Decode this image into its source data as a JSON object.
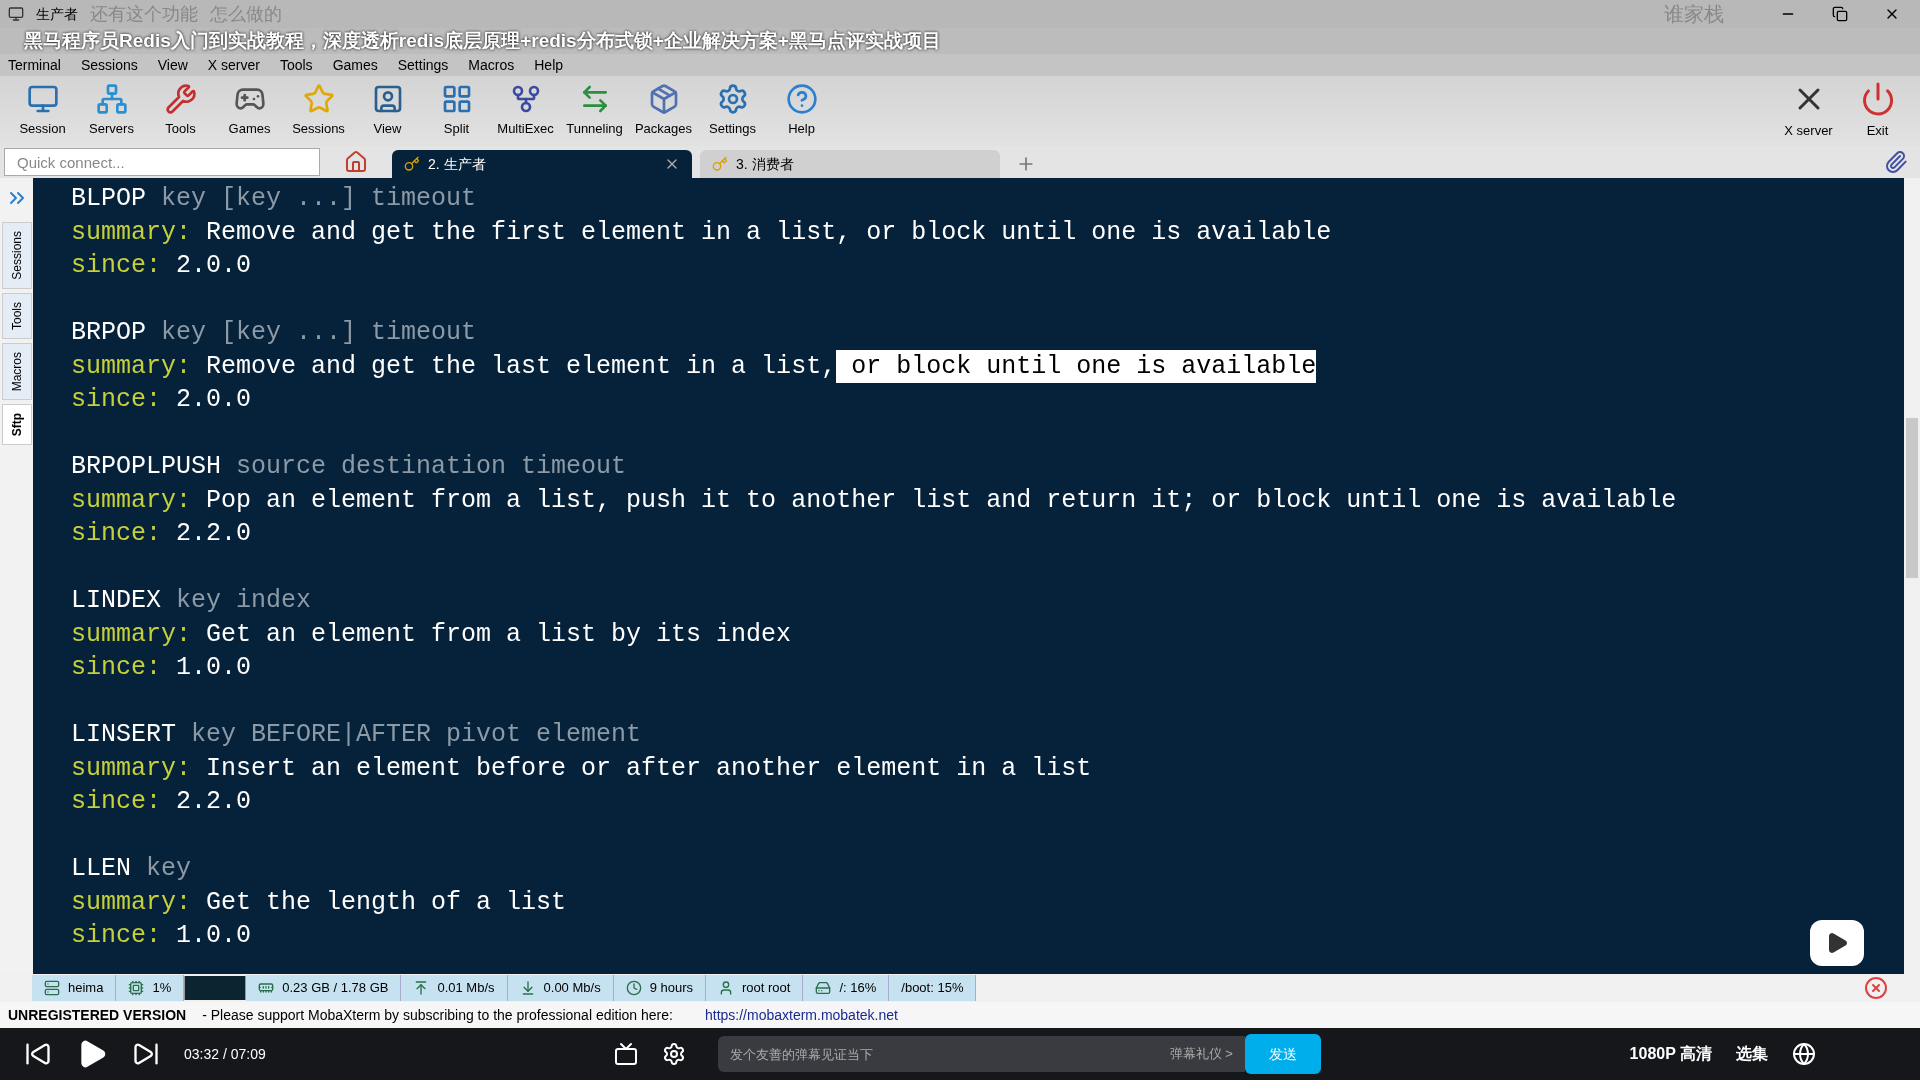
{
  "window": {
    "title": "生产者"
  },
  "danmaku": [
    "还有这个功能",
    "怎么做的",
    "谁家栈"
  ],
  "video_title": "黑马程序员Redis入门到实战教程，深度透析redis底层原理+redis分布式锁+企业解决方案+黑马点评实战项目",
  "menu": [
    "Terminal",
    "Sessions",
    "View",
    "X server",
    "Tools",
    "Games",
    "Settings",
    "Macros",
    "Help"
  ],
  "toolbar": [
    {
      "label": "Session",
      "kind": "monitor"
    },
    {
      "label": "Servers",
      "kind": "network"
    },
    {
      "label": "Tools",
      "kind": "tools"
    },
    {
      "label": "Games",
      "kind": "gamepad"
    },
    {
      "label": "Sessions",
      "kind": "star"
    },
    {
      "label": "View",
      "kind": "user"
    },
    {
      "label": "Split",
      "kind": "split"
    },
    {
      "label": "MultiExec",
      "kind": "fork"
    },
    {
      "label": "Tunneling",
      "kind": "tunnel"
    },
    {
      "label": "Packages",
      "kind": "package"
    },
    {
      "label": "Settings",
      "kind": "settings"
    },
    {
      "label": "Help",
      "kind": "help"
    }
  ],
  "toolbar_right": [
    {
      "label": "X server",
      "kind": "x"
    },
    {
      "label": "Exit",
      "kind": "power"
    }
  ],
  "quick_connect": {
    "placeholder": "Quick connect..."
  },
  "tabs": [
    {
      "label": "2. 生产者",
      "selected": true
    },
    {
      "label": "3. 消费者",
      "selected": false
    }
  ],
  "side_tabs": [
    {
      "label": "Sessions",
      "selected": false
    },
    {
      "label": "Tools",
      "selected": false
    },
    {
      "label": "Macros",
      "selected": false
    },
    {
      "label": "Sftp",
      "selected": true
    }
  ],
  "terminal": [
    {
      "command": "BLPOP",
      "args": "key [key ...] timeout",
      "summary_label": "summary:",
      "summary": [
        {
          "text": "Remove and get the first element in a list, or block until one is available",
          "selected": false
        }
      ],
      "since_label": "since:",
      "since": "2.0.0"
    },
    {
      "command": "BRPOP",
      "args": "key [key ...] timeout",
      "summary_label": "summary:",
      "summary": [
        {
          "text": "Remove and get the last element in a list,",
          "selected": false
        },
        {
          "text": " or block until one is available",
          "selected": true
        }
      ],
      "since_label": "since:",
      "since": "2.0.0"
    },
    {
      "command": "BRPOPLPUSH",
      "args": "source destination timeout",
      "summary_label": "summary:",
      "summary": [
        {
          "text": "Pop an element from a list, push it to another list and return it; or block until one is available",
          "selected": false
        }
      ],
      "since_label": "since:",
      "since": "2.2.0"
    },
    {
      "command": "LINDEX",
      "args": "key index",
      "summary_label": "summary:",
      "summary": [
        {
          "text": "Get an element from a list by its index",
          "selected": false
        }
      ],
      "since_label": "since:",
      "since": "1.0.0"
    },
    {
      "command": "LINSERT",
      "args": "key BEFORE|AFTER pivot element",
      "summary_label": "summary:",
      "summary": [
        {
          "text": "Insert an element before or after another element in a list",
          "selected": false
        }
      ],
      "since_label": "since:",
      "since": "2.2.0"
    },
    {
      "command": "LLEN",
      "args": "key",
      "summary_label": "summary:",
      "summary": [
        {
          "text": "Get the length of a list",
          "selected": false
        }
      ],
      "since_label": "since:",
      "since": "1.0.0"
    }
  ],
  "status_bar": [
    {
      "text": "heima",
      "kind": "server"
    },
    {
      "text": "1%",
      "kind": "cpu"
    },
    {
      "kind": "graph"
    },
    {
      "text": "0.23 GB / 1.78 GB",
      "kind": "memory"
    },
    {
      "text": "0.01 Mb/s",
      "kind": "upload"
    },
    {
      "text": "0.00 Mb/s",
      "kind": "download"
    },
    {
      "text": "9 hours",
      "kind": "uptime"
    },
    {
      "text": "root  root",
      "kind": "user"
    },
    {
      "text": "/: 16%",
      "kind": "disk"
    },
    {
      "text": "/boot: 15%",
      "kind": "plain"
    }
  ],
  "notice": {
    "label": "UNREGISTERED VERSION",
    "text": "-  Please support MobaXterm by subscribing to the professional edition here:",
    "link": "https://mobaxterm.mobatek.net"
  },
  "player": {
    "time": "03:32 / 07:09",
    "danmaku_placeholder": "发个友善的弹幕见证当下",
    "etiquette": "弹幕礼仪 >",
    "send": "发送",
    "quality": "1080P 高清",
    "episodes": "选集"
  }
}
